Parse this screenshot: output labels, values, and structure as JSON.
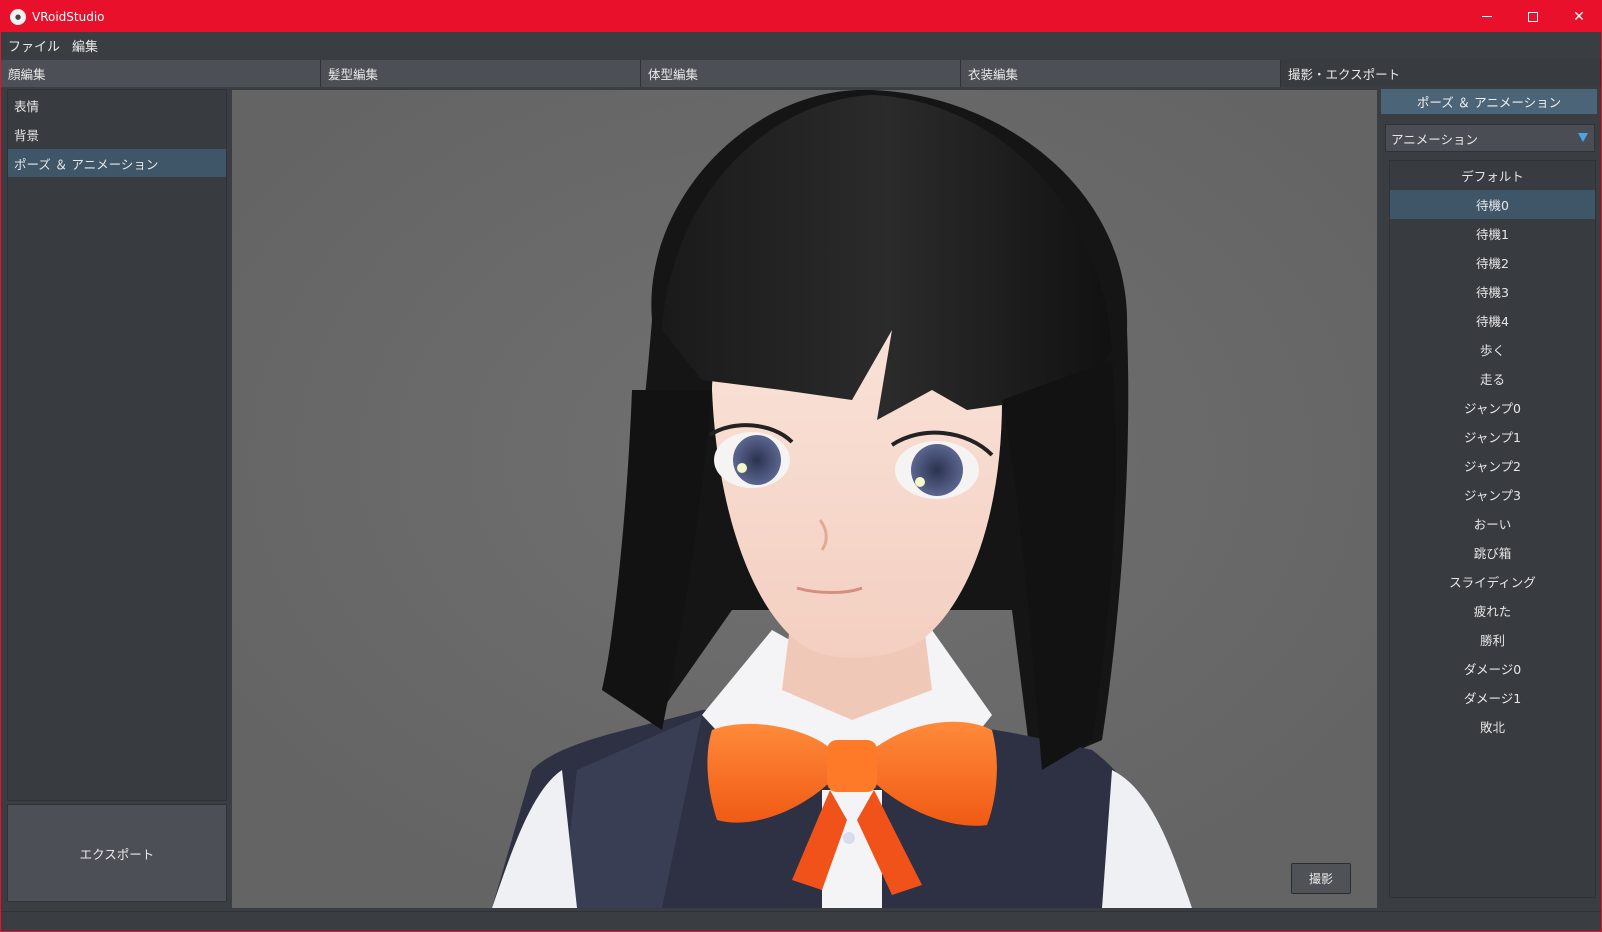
{
  "window": {
    "title": "VRoidStudio"
  },
  "menu": {
    "items": [
      "ファイル",
      "編集"
    ]
  },
  "tabs": [
    {
      "label": "顔編集",
      "active": false
    },
    {
      "label": "髪型編集",
      "active": false
    },
    {
      "label": "体型編集",
      "active": false
    },
    {
      "label": "衣装編集",
      "active": false
    },
    {
      "label": "撮影・エクスポート",
      "active": true
    }
  ],
  "left_panel": {
    "items": [
      {
        "label": "表情",
        "active": false
      },
      {
        "label": "背景",
        "active": false
      },
      {
        "label": "ポーズ ＆ アニメーション",
        "active": true
      }
    ],
    "export_label": "エクスポート"
  },
  "viewport": {
    "shoot_label": "撮影"
  },
  "right_panel": {
    "header": "ポーズ ＆ アニメーション",
    "select_value": "アニメーション",
    "animations": [
      {
        "label": "デフォルト",
        "active": false
      },
      {
        "label": "待機0",
        "active": true
      },
      {
        "label": "待機1",
        "active": false
      },
      {
        "label": "待機2",
        "active": false
      },
      {
        "label": "待機3",
        "active": false
      },
      {
        "label": "待機4",
        "active": false
      },
      {
        "label": "歩く",
        "active": false
      },
      {
        "label": "走る",
        "active": false
      },
      {
        "label": "ジャンプ0",
        "active": false
      },
      {
        "label": "ジャンプ1",
        "active": false
      },
      {
        "label": "ジャンプ2",
        "active": false
      },
      {
        "label": "ジャンプ3",
        "active": false
      },
      {
        "label": "おーい",
        "active": false
      },
      {
        "label": "跳び箱",
        "active": false
      },
      {
        "label": "スライディング",
        "active": false
      },
      {
        "label": "疲れた",
        "active": false
      },
      {
        "label": "勝利",
        "active": false
      },
      {
        "label": "ダメージ0",
        "active": false
      },
      {
        "label": "ダメージ1",
        "active": false
      },
      {
        "label": "敗北",
        "active": false
      }
    ]
  },
  "colors": {
    "titlebar": "#e8102a",
    "panel_bg": "#3a3d42",
    "selected_row": "#3f5669",
    "header_accent": "#4b6478",
    "dropdown_arrow": "#4aa3e8",
    "viewport_bg": "#6b6b6b"
  }
}
